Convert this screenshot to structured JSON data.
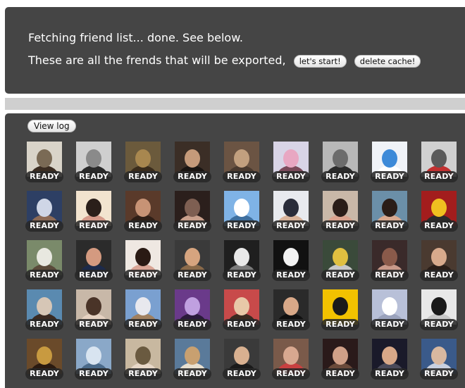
{
  "status": {
    "line1": "Fetching friend list... done. See below.",
    "line2": "These are all the frends that will be exported,",
    "start_label": "let's start!",
    "delete_cache_label": "delete cache!"
  },
  "log": {
    "view_log_label": "View log"
  },
  "friends": [
    {
      "status": "READY",
      "colors": [
        "#d9d4c9",
        "#7a6a55",
        "#3b2d22"
      ]
    },
    {
      "status": "READY",
      "colors": [
        "#cfcfcf",
        "#8a8a8a",
        "#2a2a2a"
      ]
    },
    {
      "status": "READY",
      "colors": [
        "#6b5a3c",
        "#a8874f",
        "#3a2c1c"
      ]
    },
    {
      "status": "READY",
      "colors": [
        "#3b2e26",
        "#c59a7a",
        "#1a1512"
      ]
    },
    {
      "status": "READY",
      "colors": [
        "#6b5443",
        "#c2a07f",
        "#4a3a2f"
      ]
    },
    {
      "status": "READY",
      "colors": [
        "#d8d4e6",
        "#e8a7c2",
        "#7a4a5a"
      ]
    },
    {
      "status": "READY",
      "colors": [
        "#b8b8b8",
        "#6c6c6c",
        "#2b2b2b"
      ]
    },
    {
      "status": "READY",
      "colors": [
        "#f0f3f8",
        "#3d8ad8",
        "#ffffff"
      ]
    },
    {
      "status": "READY",
      "colors": [
        "#d0d0d0",
        "#5a5a5a",
        "#c23030"
      ]
    },
    {
      "status": "READY",
      "colors": [
        "#2d3f64",
        "#cfd6e6",
        "#8c6a56"
      ]
    },
    {
      "status": "READY",
      "colors": [
        "#f2e4cf",
        "#2a1f1a",
        "#d49a8a"
      ]
    },
    {
      "status": "READY",
      "colors": [
        "#5a3a2a",
        "#c79375",
        "#2e1e16"
      ]
    },
    {
      "status": "READY",
      "colors": [
        "#2b1f1c",
        "#7e5f52",
        "#c9a08c"
      ]
    },
    {
      "status": "READY",
      "colors": [
        "#7fb3e6",
        "#ffffff",
        "#3e6f9e"
      ]
    },
    {
      "status": "READY",
      "colors": [
        "#e8eaee",
        "#2a2d3a",
        "#d9b49b"
      ]
    },
    {
      "status": "READY",
      "colors": [
        "#c9b8a8",
        "#2a1d18",
        "#dba38e"
      ]
    },
    {
      "status": "READY",
      "colors": [
        "#6b8fa8",
        "#2a1d18",
        "#d8a990"
      ]
    },
    {
      "status": "READY",
      "colors": [
        "#a31d1d",
        "#f0c020",
        "#2b2b2b"
      ]
    },
    {
      "status": "READY",
      "colors": [
        "#7a8a6a",
        "#e8e8e0",
        "#5a4a3a"
      ]
    },
    {
      "status": "READY",
      "colors": [
        "#2b2b2b",
        "#d49a80",
        "#1c2a4a"
      ]
    },
    {
      "status": "READY",
      "colors": [
        "#efe8e2",
        "#2a1a14",
        "#d9a595"
      ]
    },
    {
      "status": "READY",
      "colors": [
        "#3a3a3a",
        "#d6a47f",
        "#8a6a4a"
      ]
    },
    {
      "status": "READY",
      "colors": [
        "#1f1f1f",
        "#e8e8e8",
        "#7a7a7a"
      ]
    },
    {
      "status": "READY",
      "colors": [
        "#111111",
        "#f2f2f2",
        "#111111"
      ]
    },
    {
      "status": "READY",
      "colors": [
        "#3a4a3a",
        "#e0c040",
        "#c8c8c8"
      ]
    },
    {
      "status": "READY",
      "colors": [
        "#3a2a2a",
        "#8a5a4a",
        "#c99a8a"
      ]
    },
    {
      "status": "READY",
      "colors": [
        "#4a3a30",
        "#d8aa8c",
        "#2a1e18"
      ]
    },
    {
      "status": "READY",
      "colors": [
        "#5a8ab0",
        "#d6c6b6",
        "#3a2a22"
      ]
    },
    {
      "status": "READY",
      "colors": [
        "#c8b8a8",
        "#4a3428",
        "#e6d2c2"
      ]
    },
    {
      "status": "READY",
      "colors": [
        "#7aa0d0",
        "#e8e8ee",
        "#a08060"
      ]
    },
    {
      "status": "READY",
      "colors": [
        "#6a3a8a",
        "#c0a0e0",
        "#2a1a3a"
      ]
    },
    {
      "status": "READY",
      "colors": [
        "#c84a4a",
        "#e8c8a8",
        "#3a2a20"
      ]
    },
    {
      "status": "READY",
      "colors": [
        "#2a2a2a",
        "#d8a888",
        "#101010"
      ]
    },
    {
      "status": "READY",
      "colors": [
        "#f2c200",
        "#1a1a1a",
        "#f2c200"
      ]
    },
    {
      "status": "READY",
      "colors": [
        "#b8c0d8",
        "#ffffff",
        "#9aa2bc"
      ]
    },
    {
      "status": "READY",
      "colors": [
        "#e8e8e8",
        "#1a1a1a",
        "#c8c8c8"
      ]
    },
    {
      "status": "READY",
      "colors": [
        "#6a4a2a",
        "#c89a40",
        "#2a1a10"
      ]
    },
    {
      "status": "READY",
      "colors": [
        "#8aa8c8",
        "#d8e4f0",
        "#4a6a8a"
      ]
    },
    {
      "status": "READY",
      "colors": [
        "#c8b8a0",
        "#6a5a40",
        "#e8d8c8"
      ]
    },
    {
      "status": "READY",
      "colors": [
        "#5a7a9a",
        "#c8a070",
        "#e8e0d0"
      ]
    },
    {
      "status": "READY",
      "colors": [
        "#3a3a3a",
        "#d8b090",
        "#1a1a1a"
      ]
    },
    {
      "status": "READY",
      "colors": [
        "#7a5a4a",
        "#d8a890",
        "#c84040"
      ]
    },
    {
      "status": "READY",
      "colors": [
        "#2a1a1a",
        "#d0a088",
        "#6a4a3a"
      ]
    },
    {
      "status": "READY",
      "colors": [
        "#1a1a2a",
        "#d8a888",
        "#4a4a5a"
      ]
    },
    {
      "status": "READY",
      "colors": [
        "#3a5a8a",
        "#d8b8a0",
        "#c8d0e0"
      ]
    }
  ]
}
